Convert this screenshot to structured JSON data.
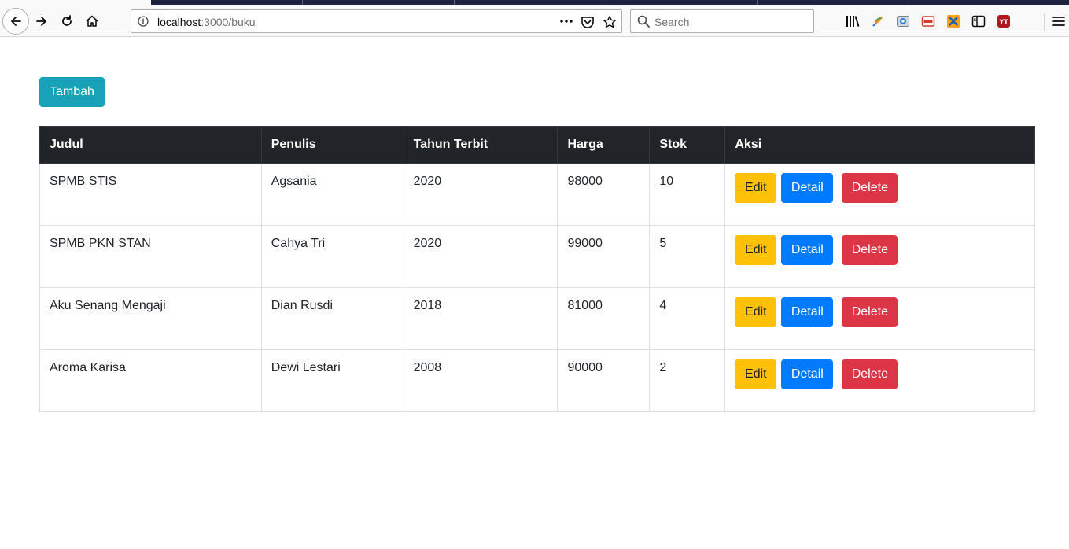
{
  "browser": {
    "url_host": "localhost",
    "url_path": ":3000/buku",
    "search_placeholder": "Search"
  },
  "page": {
    "add_button_label": "Tambah"
  },
  "table": {
    "headers": [
      "Judul",
      "Penulis",
      "Tahun Terbit",
      "Harga",
      "Stok",
      "Aksi"
    ],
    "rows": [
      {
        "judul": "SPMB STIS",
        "penulis": "Agsania",
        "tahun": "2020",
        "harga": "98000",
        "stok": "10"
      },
      {
        "judul": "SPMB PKN STAN",
        "penulis": "Cahya Tri",
        "tahun": "2020",
        "harga": "99000",
        "stok": "5"
      },
      {
        "judul": "Aku Senang Mengaji",
        "penulis": "Dian Rusdi",
        "tahun": "2018",
        "harga": "81000",
        "stok": "4"
      },
      {
        "judul": "Aroma Karisa",
        "penulis": "Dewi Lestari",
        "tahun": "2008",
        "harga": "90000",
        "stok": "2"
      }
    ],
    "actions": {
      "edit": "Edit",
      "detail": "Detail",
      "delete": "Delete"
    }
  },
  "colors": {
    "add": "#17a2b8",
    "edit": "#ffc107",
    "detail": "#007bff",
    "delete": "#dc3545",
    "header_bg": "#212529"
  }
}
